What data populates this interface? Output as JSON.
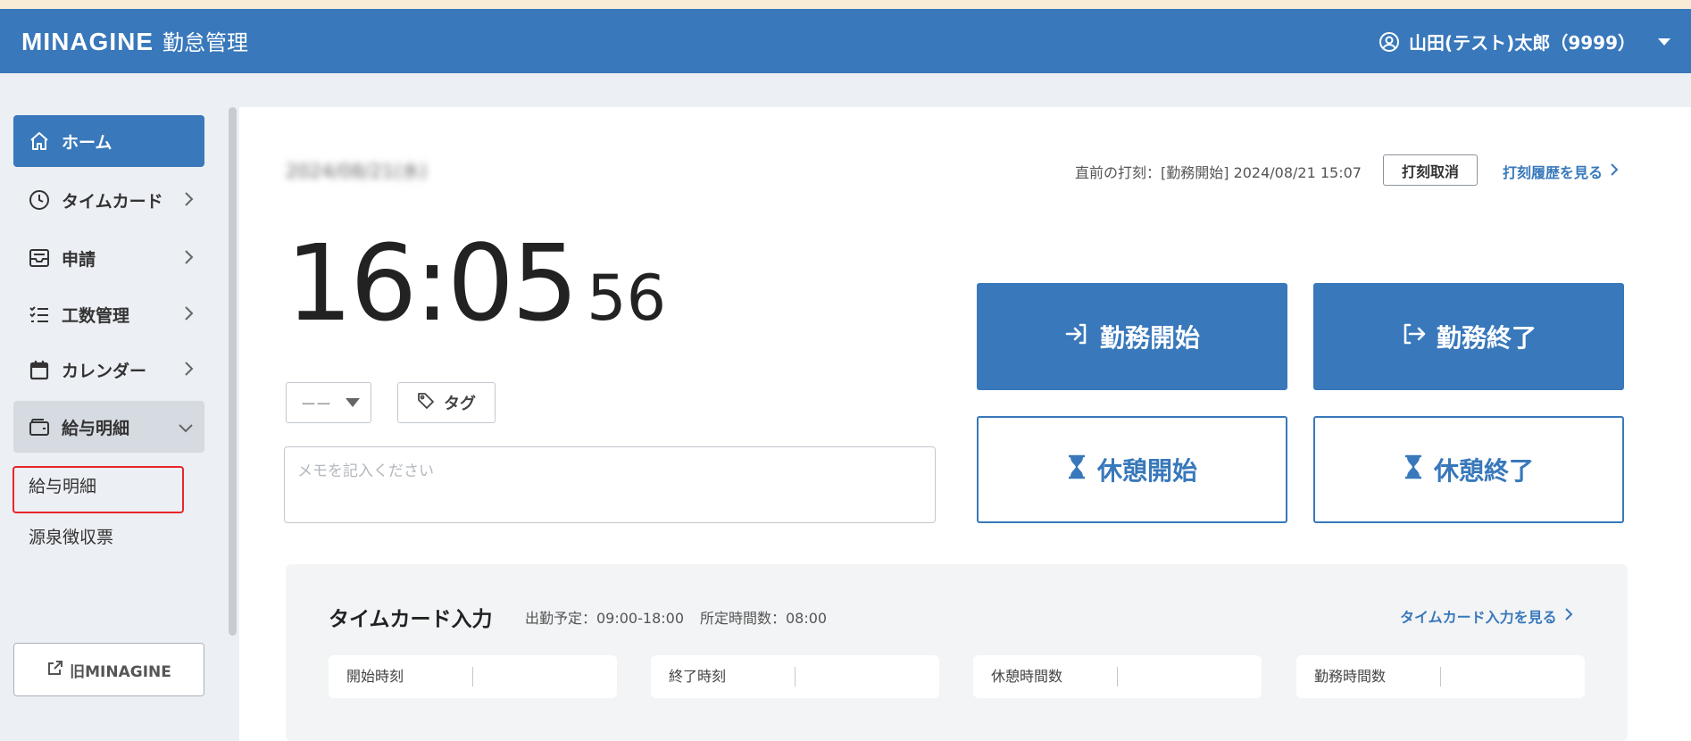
{
  "header": {
    "logo": "MINAGINE",
    "app_name": "勤怠管理",
    "user_name": "山田(テスト)太郎（9999）"
  },
  "sidebar": {
    "items": [
      {
        "label": "ホーム",
        "icon": "home-icon",
        "state": "active"
      },
      {
        "label": "タイムカード",
        "icon": "clock-icon"
      },
      {
        "label": "申請",
        "icon": "inbox-icon"
      },
      {
        "label": "工数管理",
        "icon": "checklist-icon"
      },
      {
        "label": "カレンダー",
        "icon": "calendar-icon"
      },
      {
        "label": "給与明細",
        "icon": "wallet-icon",
        "state": "expanded"
      }
    ],
    "sub_items": [
      "給与明細",
      "源泉徴収票"
    ],
    "old_link": "旧MINAGINE"
  },
  "main": {
    "date": "2024/08/21(水)",
    "last_punch": "直前の打刻：[勤務開始] 2024/08/21 15:07",
    "cancel_label": "打刻取消",
    "history_link": "打刻履歴を見る",
    "clock": {
      "hm": "16:05",
      "sec": "56"
    },
    "select_value": "ーー",
    "tag_label": "タグ",
    "memo_placeholder": "メモを記入ください",
    "buttons": {
      "work_start": "勤務開始",
      "work_end": "勤務終了",
      "break_start": "休憩開始",
      "break_end": "休憩終了"
    }
  },
  "timecard": {
    "title": "タイムカード入力",
    "schedule": "出勤予定：09:00-18:00",
    "required_hours": "所定時間数：08:00",
    "link": "タイムカード入力を見る",
    "fields": [
      {
        "label": "開始時刻",
        "value": ""
      },
      {
        "label": "終了時刻",
        "value": ""
      },
      {
        "label": "休憩時間数",
        "value": ""
      },
      {
        "label": "勤務時間数",
        "value": ""
      }
    ]
  },
  "colors": {
    "brand": "#3878bb",
    "highlight": "#e8262b"
  }
}
